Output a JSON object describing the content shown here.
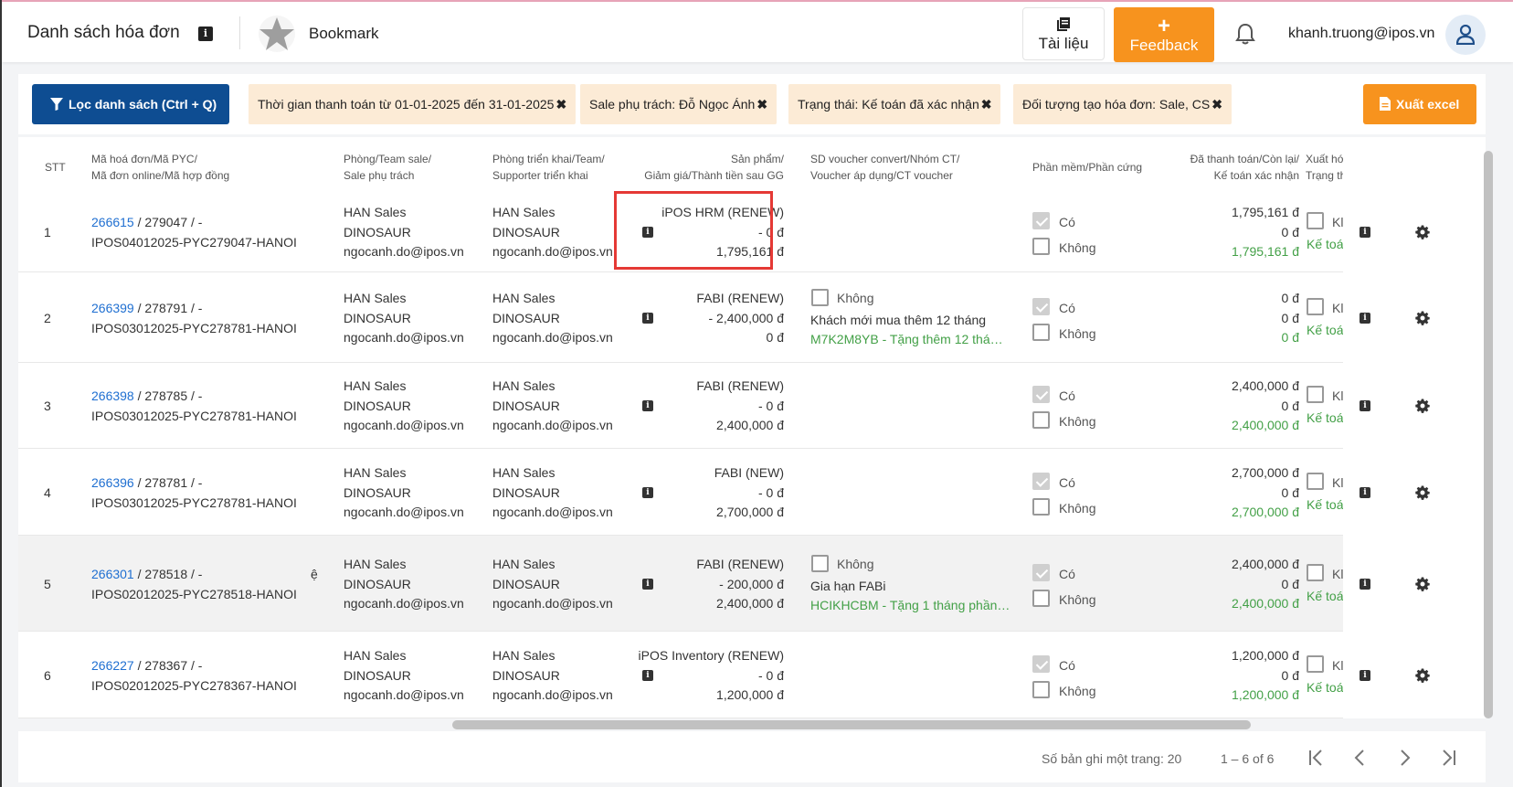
{
  "header": {
    "title": "Danh sách hóa đơn",
    "bookmark": "Bookmark",
    "docs_label": "Tài liệu",
    "feedback_plus": "+",
    "feedback_label": "Feedback",
    "user_email": "khanh.truong@ipos.vn",
    "icons": [
      "info-icon",
      "star-icon",
      "document-icon",
      "plus-icon",
      "bell-icon",
      "user-icon"
    ]
  },
  "filters": {
    "filter_button": "Lọc danh sách (Ctrl + Q)",
    "chips": [
      "Thời gian thanh toán từ 01-01-2025 đến 31-01-2025",
      "Sale phụ trách: Đỗ Ngọc Ánh",
      "Trạng thái: Kế toán đã xác nhận",
      "Đối tượng tạo hóa đơn: Sale, CS"
    ],
    "chip_close": "✖",
    "export_button": "Xuất excel"
  },
  "table": {
    "headers": {
      "stt": "STT",
      "code_1": "Mã hoá đơn/Mã PYC/",
      "code_2": "Mã đơn online/Mã hợp đồng",
      "team_1": "Phòng/Team sale/",
      "team_2": "Sale phụ trách",
      "deploy_1": "Phòng triển khai/Team/",
      "deploy_2": "Supporter triển khai",
      "product_1": "Sản phẩm/",
      "product_2": "Giảm giá/Thành tiền sau GG",
      "voucher_1": "SD voucher convert/Nhóm CT/",
      "voucher_2": "Voucher áp dụng/CT voucher",
      "sw_hw": "Phần mềm/Phần cứng",
      "paid_1": "Đã thanh toán/Còn lại/",
      "paid_2": "Kế toán xác nhận",
      "export_1": "Xuất hó",
      "export_2": "Trạng th"
    },
    "labels": {
      "yes": "Có",
      "no": "Không",
      "voucher_no": "Không",
      "export_partial": "Kl",
      "accountant_partial": "Kế toá"
    },
    "rows": [
      {
        "stt": "1",
        "invoice": "266615",
        "rest": " / 279047 / -",
        "code2": "IPOS04012025-PYC279047-HANOI",
        "extra": "",
        "team": "HAN Sales",
        "team2": "DINOSAUR",
        "email": "ngocanh.do@ipos.vn",
        "deploy": "HAN Sales",
        "deploy2": "DINOSAUR",
        "deploy_email": "ngocanh.do@ipos.vn",
        "product": "iPOS HRM (RENEW)",
        "discount": "- 0 đ",
        "total": "1,795,161 đ",
        "voucher": false,
        "voucher_name": "",
        "voucher_code": "",
        "paid": "1,795,161 đ",
        "remaining": "0 đ",
        "confirmed": "1,795,161 đ"
      },
      {
        "stt": "2",
        "invoice": "266399",
        "rest": " / 278791 / -",
        "code2": "IPOS03012025-PYC278781-HANOI",
        "extra": "",
        "team": "HAN Sales",
        "team2": "DINOSAUR",
        "email": "ngocanh.do@ipos.vn",
        "deploy": "HAN Sales",
        "deploy2": "DINOSAUR",
        "deploy_email": "ngocanh.do@ipos.vn",
        "product": "FABI (RENEW)",
        "discount": "- 2,400,000 đ",
        "total": "0 đ",
        "voucher": true,
        "voucher_name": "Khách mới mua thêm 12 tháng",
        "voucher_code": "M7K2M8YB - Tặng thêm 12 thá…",
        "paid": "0 đ",
        "remaining": "0 đ",
        "confirmed": "0 đ"
      },
      {
        "stt": "3",
        "invoice": "266398",
        "rest": " / 278785 / -",
        "code2": "IPOS03012025-PYC278781-HANOI",
        "extra": "",
        "team": "HAN Sales",
        "team2": "DINOSAUR",
        "email": "ngocanh.do@ipos.vn",
        "deploy": "HAN Sales",
        "deploy2": "DINOSAUR",
        "deploy_email": "ngocanh.do@ipos.vn",
        "product": "FABI (RENEW)",
        "discount": "- 0 đ",
        "total": "2,400,000 đ",
        "voucher": false,
        "voucher_name": "",
        "voucher_code": "",
        "paid": "2,400,000 đ",
        "remaining": "0 đ",
        "confirmed": "2,400,000 đ"
      },
      {
        "stt": "4",
        "invoice": "266396",
        "rest": " / 278781 / -",
        "code2": "IPOS03012025-PYC278781-HANOI",
        "extra": "",
        "team": "HAN Sales",
        "team2": "DINOSAUR",
        "email": "ngocanh.do@ipos.vn",
        "deploy": "HAN Sales",
        "deploy2": "DINOSAUR",
        "deploy_email": "ngocanh.do@ipos.vn",
        "product": "FABI (NEW)",
        "discount": "- 0 đ",
        "total": "2,700,000 đ",
        "voucher": false,
        "voucher_name": "",
        "voucher_code": "",
        "paid": "2,700,000 đ",
        "remaining": "0 đ",
        "confirmed": "2,700,000 đ"
      },
      {
        "stt": "5",
        "invoice": "266301",
        "rest": " / 278518 / -",
        "code2": "IPOS02012025-PYC278518-HANOI",
        "extra": "ệ",
        "team": "HAN Sales",
        "team2": "DINOSAUR",
        "email": "ngocanh.do@ipos.vn",
        "deploy": "HAN Sales",
        "deploy2": "DINOSAUR",
        "deploy_email": "ngocanh.do@ipos.vn",
        "product": "FABI (RENEW)",
        "discount": "- 200,000 đ",
        "total": "2,400,000 đ",
        "voucher": true,
        "voucher_name": "Gia hạn FABi",
        "voucher_code": "HCIKHCBM - Tặng 1 tháng phần…",
        "paid": "2,400,000 đ",
        "remaining": "0 đ",
        "confirmed": "2,400,000 đ"
      },
      {
        "stt": "6",
        "invoice": "266227",
        "rest": " / 278367 / -",
        "code2": "IPOS02012025-PYC278367-HANOI",
        "extra": "",
        "team": "HAN Sales",
        "team2": "DINOSAUR",
        "email": "ngocanh.do@ipos.vn",
        "deploy": "HAN Sales",
        "deploy2": "DINOSAUR",
        "deploy_email": "ngocanh.do@ipos.vn",
        "product": "iPOS Inventory (RENEW)",
        "discount": "- 0 đ",
        "total": "1,200,000 đ",
        "voucher": false,
        "voucher_name": "",
        "voucher_code": "",
        "paid": "1,200,000 đ",
        "remaining": "0 đ",
        "confirmed": "1,200,000 đ"
      }
    ]
  },
  "footer": {
    "rows_per_page": "Số bản ghi một trang: 20",
    "range": "1 – 6 of 6"
  },
  "colors": {
    "primary": "#0e4d92",
    "accent": "#f7931e",
    "chip_bg": "#fcebd6",
    "link": "#1f6fd1",
    "green": "#43a047",
    "highlight": "#e53935"
  }
}
